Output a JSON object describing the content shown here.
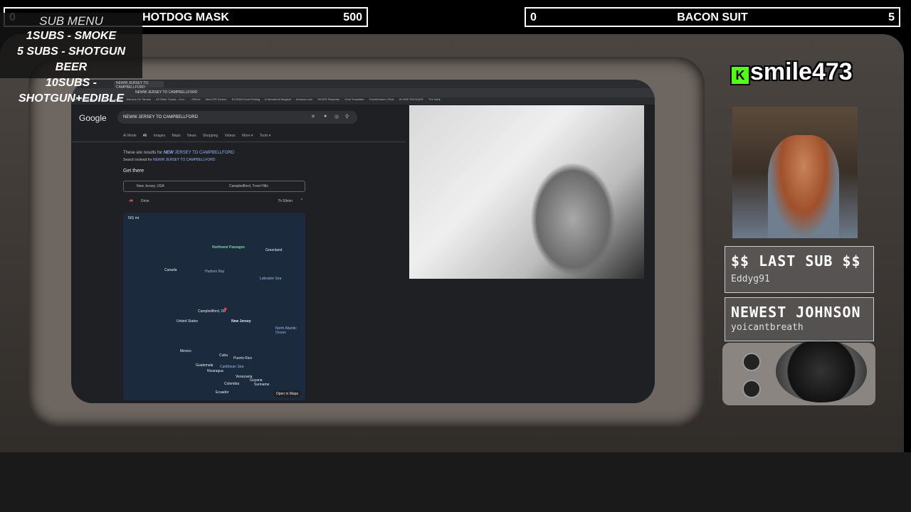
{
  "goals": [
    {
      "current": "0",
      "name": "HOTDOG MASK",
      "target": "500"
    },
    {
      "current": "0",
      "name": "BACON SUIT",
      "target": "5"
    }
  ],
  "submenu": {
    "title": "SUB MENU",
    "lines": [
      "1SUBS   - SMOKE",
      "5 SUBS  - SHOTGUN BEER",
      "10SUBS - SHOTGUN+EDIBLE"
    ]
  },
  "browser": {
    "tab_title": "NEWW JERSEY TO CAMPBELLFORD",
    "url": "NEWW JERSEY TO CAMPBELLFORD",
    "bookmarks": [
      "Creator Dashboard",
      "Vegus I'm magic",
      "Warlock On Stream",
      "All Other Tracks - Goo...",
      "GitHub",
      "AlexCSR Screen",
      "ECONW Excel Rolling",
      "A Wonderful Magical",
      "Amazon.com",
      "VEXER Repeater",
      "Chat Translator",
      "FreshDrawer | Rust",
      "IN-ONE PACKAGE",
      "The Vault"
    ],
    "google": {
      "logo": "Google",
      "query": "NEWW JERSEY TO CAMPBELLFORD",
      "tabs": [
        "AI Mode",
        "All",
        "Images",
        "Maps",
        "News",
        "Shopping",
        "Videos",
        "More ▾",
        "Tools ▾"
      ],
      "selected_tab": "All",
      "results_prefix": "These are results for",
      "results_bold": "NEW",
      "results_rest": " JERSEY TO CAMPBELLFORD",
      "search_instead_prefix": "Search instead for",
      "search_instead_query": "NEWW JERSEY TO CAMPBELLFORD",
      "get_there": "Get there",
      "route_from": "New Jersey, USA",
      "route_to": "Campbellford, Trent Hills",
      "mode": "Drive",
      "time": "7h 59min",
      "map": {
        "scale": "501 mi",
        "labels": {
          "greenland": "Greenland",
          "canada": "Canada",
          "hudson": "Hudson Bay",
          "us": "United States",
          "campbellford": "Campbellford, On",
          "nj": "New Jersey",
          "atlantic": "North Atlantic Ocean",
          "mexico": "Mexico",
          "cuba": "Cuba",
          "pr": "Puerto Rico",
          "guatemala": "Guatemala",
          "nicaragua": "Nicaragua",
          "venezuela": "Venezuela",
          "colombia": "Colombia",
          "ecuador": "Ecuador",
          "guyana": "Guyana",
          "suriname": "Suriname",
          "labrador": "Labrador Sea",
          "caribbean": "Caribbean Sea",
          "northwest": "Northwest Passages"
        },
        "open_label": "Open in Maps"
      }
    }
  },
  "kick": {
    "username": "smile473"
  },
  "last_sub": {
    "heading": "$$ LAST SUB $$",
    "value": "Eddyg91"
  },
  "newest": {
    "heading": "NEWEST JOHNSON",
    "value": "yoicantbreath"
  }
}
